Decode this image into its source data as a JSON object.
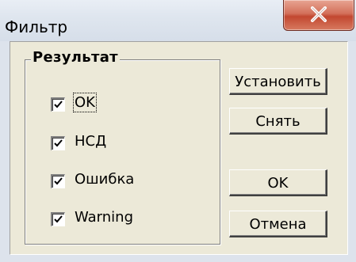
{
  "window": {
    "title": "Фильтр",
    "close_icon": "close-x-icon"
  },
  "group": {
    "title": "Результат",
    "items": [
      {
        "label": "OK",
        "checked": true,
        "focused": true
      },
      {
        "label": "НСД",
        "checked": true,
        "focused": false
      },
      {
        "label": "Ошибка",
        "checked": true,
        "focused": false
      },
      {
        "label": "Warning",
        "checked": true,
        "focused": false
      }
    ]
  },
  "buttons": {
    "set_label": "Установить",
    "clear_label": "Снять",
    "ok_label": "OK",
    "cancel_label": "Отмена"
  }
}
